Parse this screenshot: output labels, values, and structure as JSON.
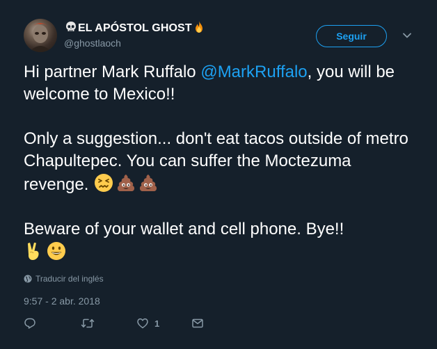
{
  "author": {
    "display_name": "EL APÓSTOL GHOST",
    "handle": "@ghostlaoch",
    "name_icons": [
      "skull-icon",
      "fire-icon"
    ]
  },
  "follow_button": {
    "label": "Seguir"
  },
  "tweet": {
    "line1_prefix": "Hi partner Mark Ruffalo ",
    "mention": "@MarkRuffalo",
    "line1_suffix": ", you will be welcome to Mexico!!",
    "para2": "Only a suggestion... don't eat tacos outside of metro Chapultepec. You can suffer the Moctezuma revenge.",
    "para2_emojis": [
      "confounded-face-icon",
      "pile-of-poo-icon",
      "pile-of-poo-icon"
    ],
    "para3": "Beware of your wallet and cell phone. Bye!!",
    "para3_emojis": [
      "victory-hand-icon",
      "grinning-face-icon"
    ]
  },
  "translate": {
    "label": "Traducir del inglés"
  },
  "timestamp": "9:57 - 2 abr. 2018",
  "actions": {
    "reply": {
      "icon": "reply-icon"
    },
    "retweet": {
      "icon": "retweet-icon"
    },
    "like": {
      "icon": "heart-icon",
      "count": "1"
    },
    "dm": {
      "icon": "envelope-icon"
    }
  },
  "colors": {
    "background": "#15202b",
    "accent": "#1da1f2",
    "muted": "#8899a6",
    "text": "#ffffff"
  }
}
